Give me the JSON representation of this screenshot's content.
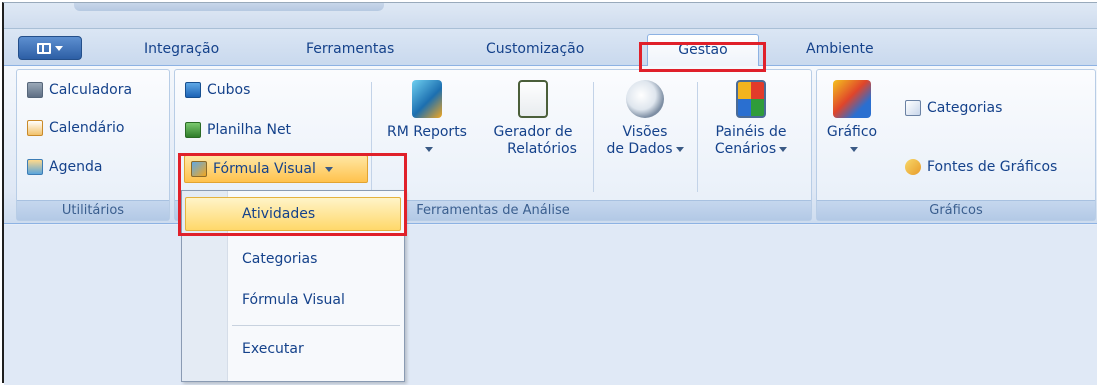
{
  "tabs": [
    "Integração",
    "Ferramentas",
    "Customização",
    "Gestão",
    "Ambiente"
  ],
  "active_tab": "Gestão",
  "groups": {
    "utilitarios": {
      "label": "Utilitários",
      "items": [
        "Calculadora",
        "Calendário",
        "Agenda"
      ]
    },
    "analise": {
      "label": "Ferramentas de Análise",
      "small_items": [
        "Cubos",
        "Planilha Net",
        "Fórmula Visual"
      ],
      "large_items": [
        {
          "line1": "RM Reports",
          "line2": ""
        },
        {
          "line1": "Gerador de",
          "line2": "Relatórios"
        },
        {
          "line1": "Visões",
          "line2": "de Dados"
        },
        {
          "line1": "Painéis de",
          "line2": "Cenários"
        }
      ]
    },
    "graficos": {
      "label": "Gráficos",
      "large_item": "Gráfico",
      "small_items": [
        "Categorias",
        "Fontes de Gráficos"
      ]
    }
  },
  "menu": {
    "items": [
      "Atividades",
      "Categorias",
      "Fórmula Visual",
      "Executar"
    ],
    "highlighted": "Atividades"
  },
  "colors": {
    "accent_red": "#e0202a",
    "highlight": "#ffd86a",
    "text": "#15428b"
  },
  "icons": {
    "calculadora": "calculator-icon",
    "calendario": "calendar-icon",
    "agenda": "agenda-icon",
    "cubos": "cube-icon",
    "planilha": "spreadsheet-icon",
    "formula": "formula-icon",
    "rm_reports": "report-icon",
    "gerador": "report-generator-icon",
    "visoes": "sql-magnifier-icon",
    "paineis": "dashboard-icon",
    "grafico": "chart-icon",
    "categorias": "category-chart-icon",
    "fontes": "chart-source-icon"
  }
}
